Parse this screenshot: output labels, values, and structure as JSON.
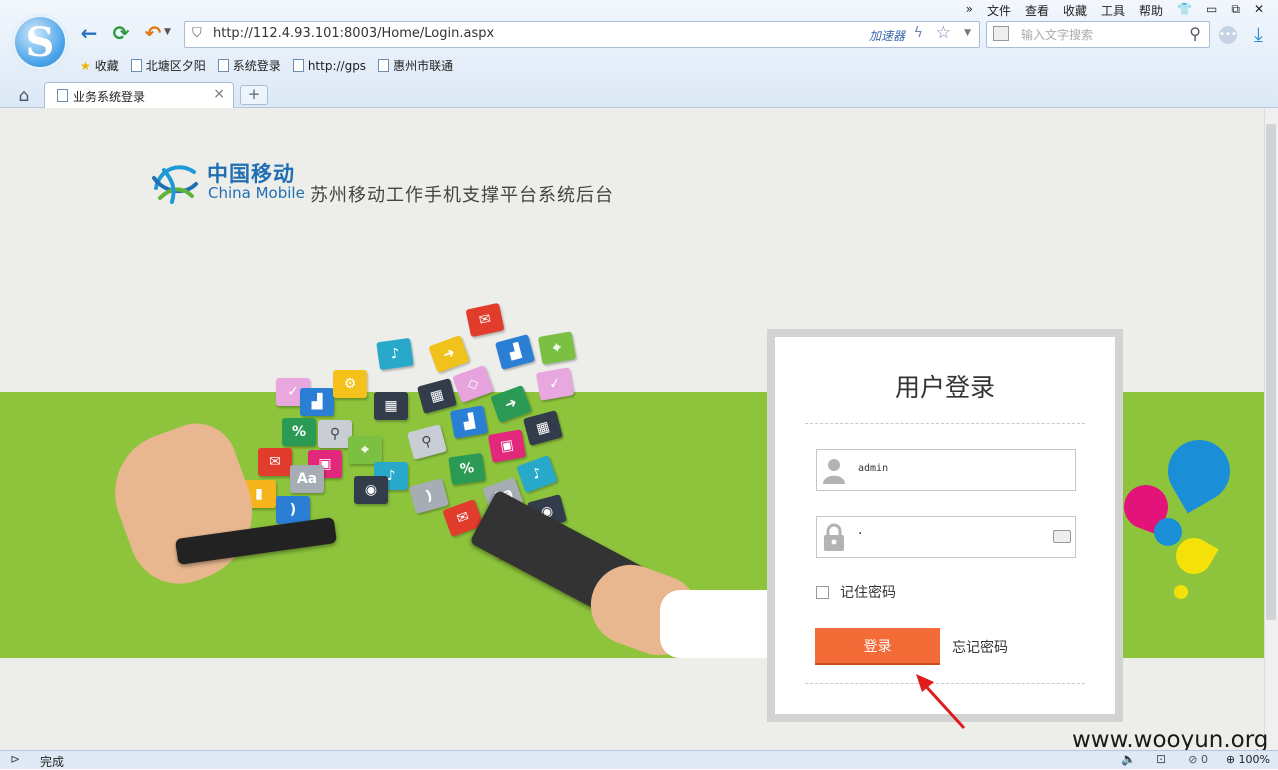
{
  "browser": {
    "menu": [
      "»",
      "文件",
      "查看",
      "收藏",
      "工具",
      "帮助"
    ],
    "address_url": "http://112.4.93.101:8003/Home/Login.aspx",
    "accelerator_label": "加速器",
    "search_placeholder": "输入文字搜索",
    "bookmarks": [
      "收藏",
      "北塘区夕阳",
      "系统登录",
      "http://gps",
      "惠州市联通"
    ],
    "tab_title": "业务系统登录",
    "status_text": "完成",
    "zoom": "100%",
    "counter": "0"
  },
  "page": {
    "brand_cn": "中国移动",
    "brand_en": "China Mobile",
    "system_title": "苏州移动工作手机支撑平台系统后台",
    "login": {
      "title": "用户登录",
      "username_value": "admin",
      "password_value": "·",
      "remember_label": "记住密码",
      "remember_checked": false,
      "submit_label": "登录",
      "forgot_label": "忘记密码"
    }
  },
  "watermark": "www.wooyun.org",
  "colors": {
    "green_band": "#8dc43c",
    "login_button": "#f36b36",
    "brand_blue": "#1f6fb5"
  }
}
